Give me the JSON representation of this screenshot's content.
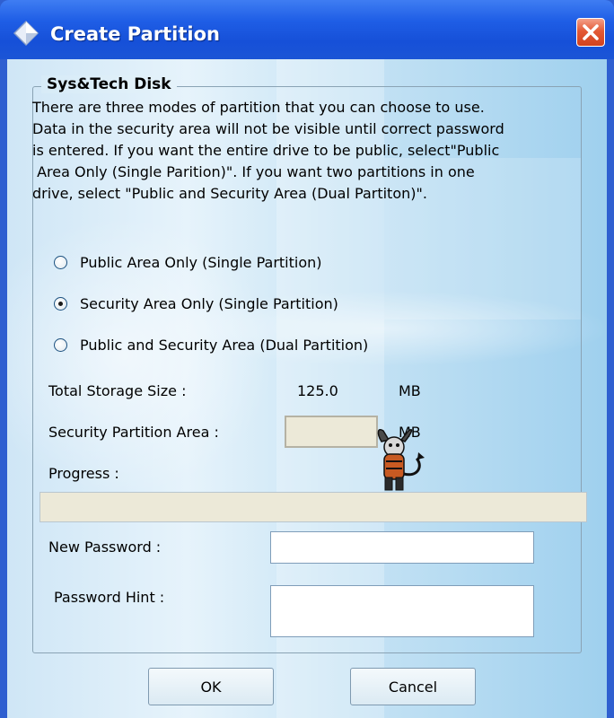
{
  "window": {
    "title": "Create Partition",
    "title_icon": "diamond-icon",
    "close_icon": "close-icon"
  },
  "group": {
    "title": "Sys&Tech Disk",
    "description_lines": [
      "There are three modes of partition that you can choose to use.",
      "Data in the security area will not be visible until correct password",
      "is entered. If you want the entire drive to be public, select\"Public",
      " Area Only (Single Parition)\". If you want two partitions in one",
      "drive, select \"Public and Security Area (Dual Partiton)\"."
    ]
  },
  "modes": [
    {
      "label": "Public Area Only (Single Partition)",
      "checked": false
    },
    {
      "label": "Security Area Only (Single Partition)",
      "checked": true
    },
    {
      "label": "Public and Security Area (Dual Partition)",
      "checked": false
    }
  ],
  "storage": {
    "total_label": "Total Storage Size :",
    "total_value": "125.0",
    "total_unit": "MB",
    "security_label": "Security Partition Area :",
    "security_value": "",
    "security_unit": "MB"
  },
  "progress": {
    "label": "Progress :",
    "value": 0
  },
  "password": {
    "new_label": "New Password :",
    "new_value": "",
    "hint_label": "Password Hint :",
    "hint_value": ""
  },
  "buttons": {
    "ok": "OK",
    "cancel": "Cancel"
  },
  "colors": {
    "titlebar": "#1f5ee6",
    "close_button": "#d2421e"
  }
}
